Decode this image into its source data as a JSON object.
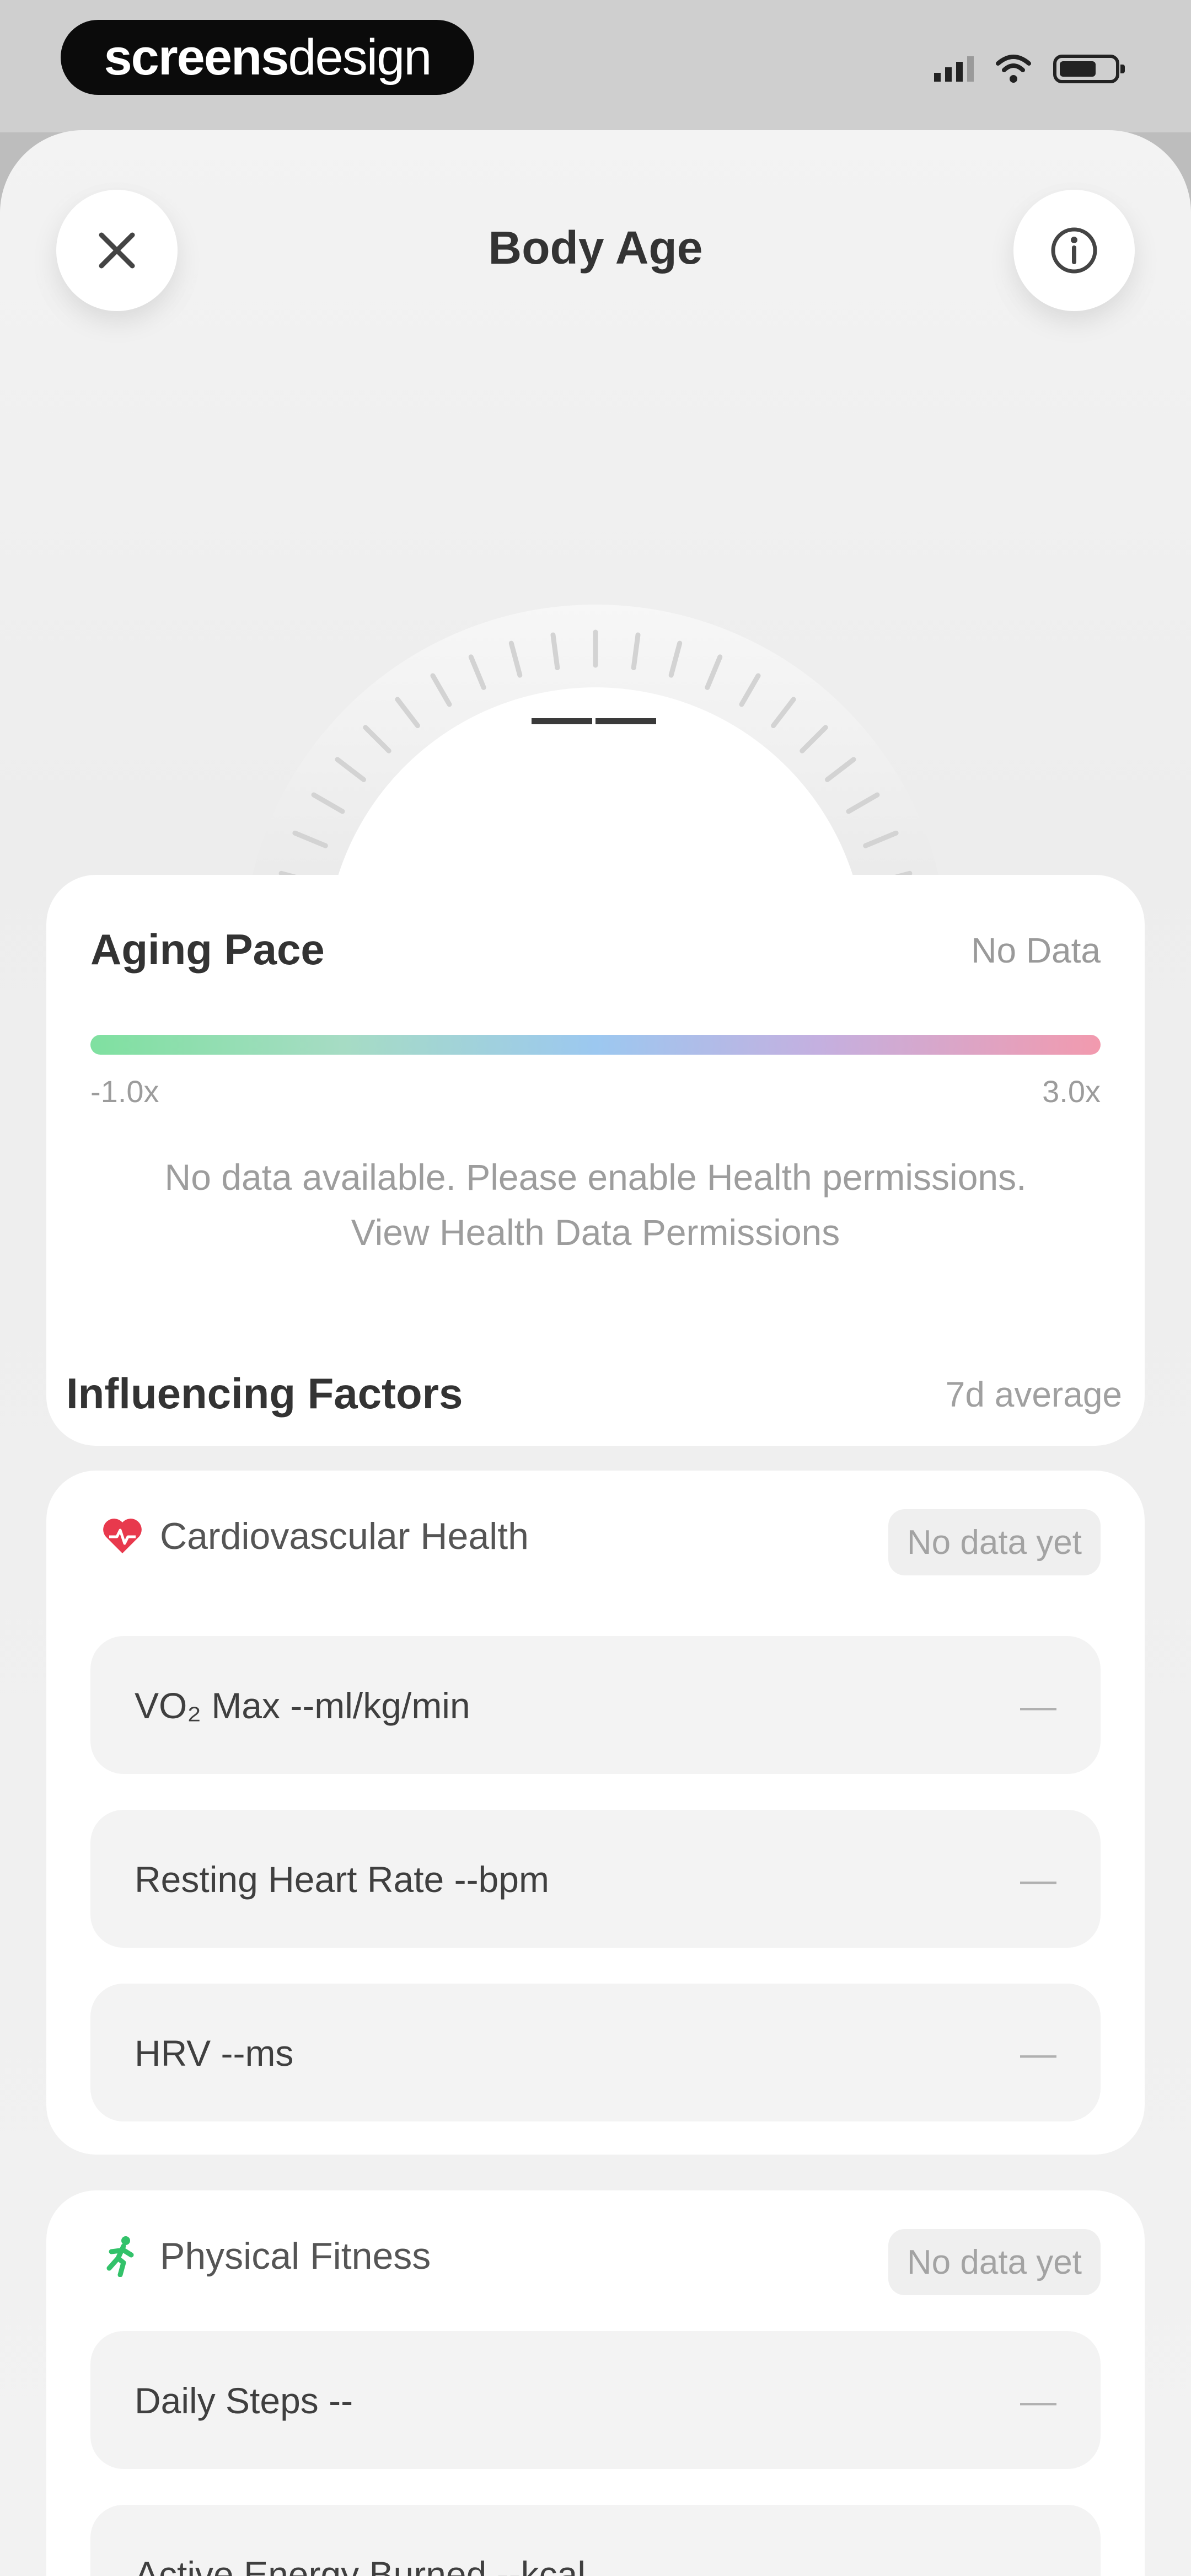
{
  "status_bar": {
    "brand_bold": "screens",
    "brand_light": "design"
  },
  "sheet": {
    "title": "Body Age",
    "gauge_value": "——"
  },
  "aging_pace": {
    "title": "Aging Pace",
    "status": "No Data",
    "min_label": "-1.0x",
    "max_label": "3.0x",
    "message": "No data available. Please enable Health permissions.",
    "link": "View Health Data Permissions"
  },
  "influencing_factors": {
    "title": "Influencing Factors",
    "subtitle": "7d average",
    "groups": [
      {
        "label": "Cardiovascular Health",
        "icon": "heart-icon",
        "chip": "No data yet",
        "metrics": [
          {
            "name": "VO₂ Max --ml/kg/min",
            "value": "—"
          },
          {
            "name": "Resting Heart Rate --bpm",
            "value": "—"
          },
          {
            "name": "HRV --ms",
            "value": "—"
          }
        ]
      },
      {
        "label": "Physical Fitness",
        "icon": "runner-icon",
        "chip": "No data yet",
        "metrics": [
          {
            "name": "Daily Steps --",
            "value": "—"
          },
          {
            "name": "Active Energy Burned --kcal",
            "value": "—"
          }
        ]
      }
    ]
  },
  "colors": {
    "heart": "#e8394d",
    "runner": "#33c26a",
    "pace_gradient": [
      "#7fe0a0",
      "#9cc8f0",
      "#c4b0e0",
      "#f29aae"
    ]
  }
}
